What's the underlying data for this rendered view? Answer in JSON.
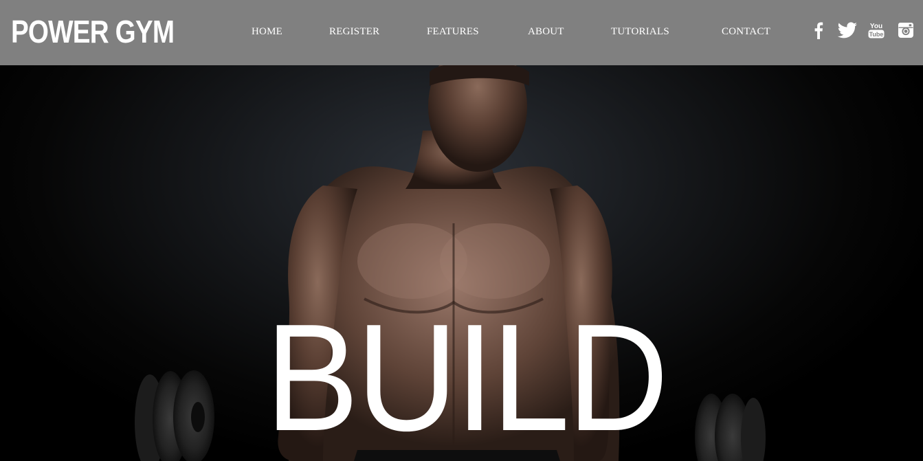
{
  "header": {
    "logo": "POWER GYM",
    "background_color": "#808080",
    "nav": [
      {
        "label": "HOME"
      },
      {
        "label": "REGISTER"
      },
      {
        "label": "FEATURES"
      },
      {
        "label": "ABOUT"
      },
      {
        "label": "TUTORIALS"
      },
      {
        "label": "CONTACT"
      }
    ],
    "social": [
      {
        "icon": "facebook-icon"
      },
      {
        "icon": "twitter-icon"
      },
      {
        "icon": "youtube-icon",
        "text_top": "You",
        "text_bottom": "Tube"
      },
      {
        "icon": "instagram-icon"
      }
    ]
  },
  "hero": {
    "title": "BUILD",
    "image": "muscular-man-lifting-barbell-photo"
  }
}
